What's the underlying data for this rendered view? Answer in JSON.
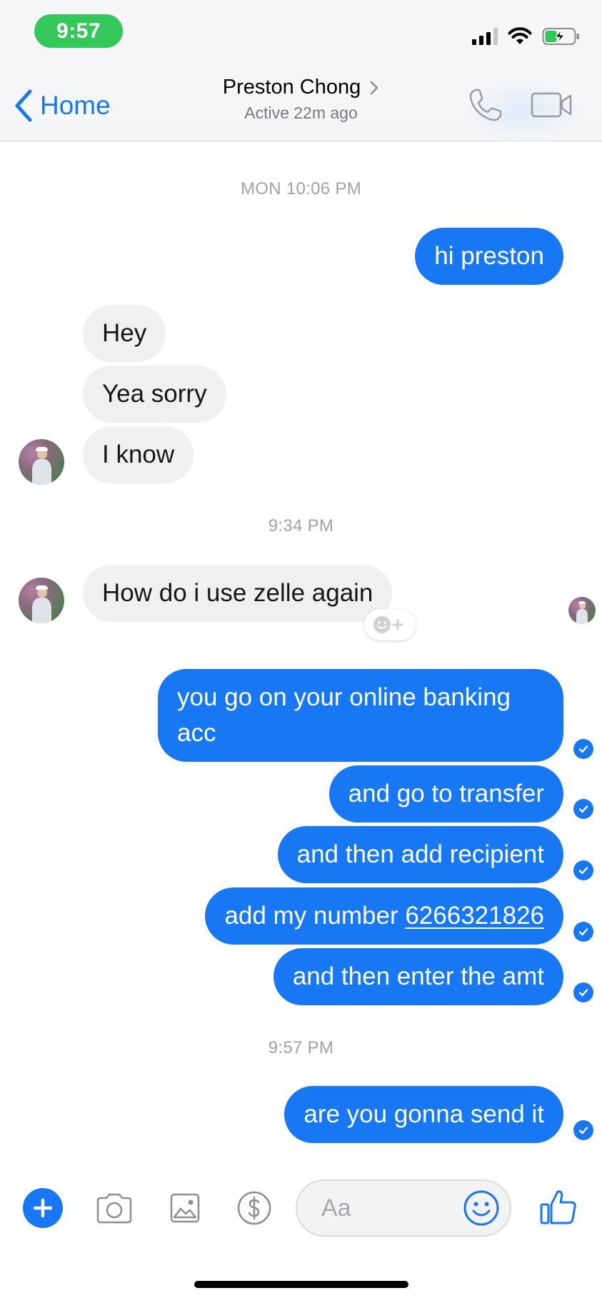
{
  "status_bar": {
    "time": "9:57"
  },
  "header": {
    "back_label": "Home",
    "contact_name": "Preston Chong",
    "contact_status": "Active 22m ago"
  },
  "conversation": {
    "timestamps": [
      "MON 10:06 PM",
      "9:34 PM",
      "9:57 PM"
    ],
    "messages": [
      {
        "direction": "outgoing",
        "text": "hi preston"
      },
      {
        "direction": "incoming",
        "text": "Hey"
      },
      {
        "direction": "incoming",
        "text": "Yea sorry"
      },
      {
        "direction": "incoming",
        "text": "I know"
      },
      {
        "direction": "incoming",
        "text": "How do i use zelle again"
      },
      {
        "direction": "outgoing",
        "text": "you go on your online banking acc"
      },
      {
        "direction": "outgoing",
        "text": "and go to transfer"
      },
      {
        "direction": "outgoing",
        "text": "and then add recipient"
      },
      {
        "direction": "outgoing",
        "text_prefix": "add my number ",
        "link": "6266321826"
      },
      {
        "direction": "outgoing",
        "text": "and then enter the amt"
      },
      {
        "direction": "outgoing",
        "text": "are you gonna send it"
      }
    ]
  },
  "composer": {
    "placeholder": "Aa"
  },
  "colors": {
    "accent": "#1877f2",
    "incoming_bubble": "#f0f0f0",
    "time_pill": "#34c759",
    "timestamp_text": "#a2a2a6"
  },
  "icons": [
    "back-chevron-icon",
    "chevron-right-icon",
    "phone-icon",
    "video-camera-icon",
    "cellular-signal-icon",
    "wifi-icon",
    "battery-charging-icon",
    "add-reaction-icon",
    "delivered-check-icon",
    "plus-icon",
    "camera-icon",
    "photo-icon",
    "payment-dollar-icon",
    "emoji-icon",
    "thumbs-up-icon"
  ]
}
